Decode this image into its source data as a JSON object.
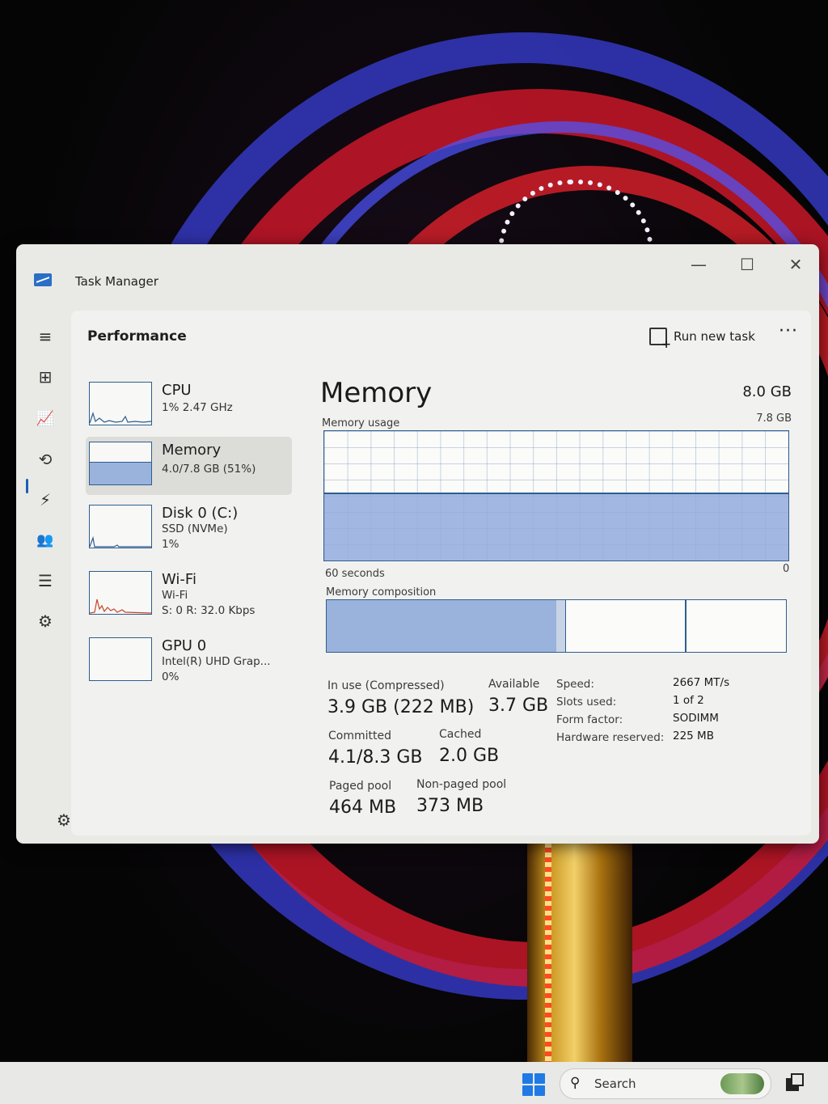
{
  "window": {
    "title": "Task Manager",
    "minimize_glyph": "—",
    "maximize_glyph": "☐",
    "close_glyph": "✕"
  },
  "nav": {
    "items": [
      {
        "icon": "hamburger-menu-icon",
        "glyph": "≡"
      },
      {
        "icon": "processes-icon",
        "glyph": "⊞"
      },
      {
        "icon": "performance-icon",
        "glyph": "📈"
      },
      {
        "icon": "app-history-icon",
        "glyph": "⟲"
      },
      {
        "icon": "startup-apps-icon",
        "glyph": "⚡"
      },
      {
        "icon": "users-icon",
        "glyph": "👥"
      },
      {
        "icon": "details-icon",
        "glyph": "☰"
      },
      {
        "icon": "services-icon",
        "glyph": "⚙"
      }
    ],
    "settings_glyph": "⚙"
  },
  "header": {
    "title": "Performance",
    "run_new_task_label": "Run new task",
    "more_glyph": "···"
  },
  "resources": [
    {
      "name": "CPU",
      "line1": "1% 2.47 GHz",
      "line2": ""
    },
    {
      "name": "Memory",
      "line1": "4.0/7.8 GB (51%)",
      "line2": ""
    },
    {
      "name": "Disk 0 (C:)",
      "line1": "SSD (NVMe)",
      "line2": "1%"
    },
    {
      "name": "Wi-Fi",
      "line1": "Wi-Fi",
      "line2": "S: 0 R: 32.0 Kbps"
    },
    {
      "name": "GPU 0",
      "line1": "Intel(R) UHD Grap...",
      "line2": "0%"
    }
  ],
  "memory_panel": {
    "title": "Memory",
    "total": "8.0 GB",
    "usage_label": "Memory usage",
    "usage_max": "7.8 GB",
    "time_span": "60 seconds",
    "axis_min": "0",
    "usage_fraction": 0.51,
    "composition_label": "Memory composition",
    "composition": {
      "in_use_fraction": 0.5,
      "modified_fraction": 0.02,
      "standby_fraction": 0.26,
      "free_fraction": 0.22
    },
    "stats": {
      "in_use_label": "In use (Compressed)",
      "in_use_value": "3.9 GB (222 MB)",
      "available_label": "Available",
      "available_value": "3.7 GB",
      "committed_label": "Committed",
      "committed_value": "4.1/8.3 GB",
      "cached_label": "Cached",
      "cached_value": "2.0 GB",
      "paged_pool_label": "Paged pool",
      "paged_pool_value": "464 MB",
      "non_paged_pool_label": "Non-paged pool",
      "non_paged_pool_value": "373 MB"
    },
    "specs": {
      "speed_label": "Speed:",
      "speed_value": "2667 MT/s",
      "slots_label": "Slots used:",
      "slots_value": "1 of 2",
      "form_factor_label": "Form factor:",
      "form_factor_value": "SODIMM",
      "hw_reserved_label": "Hardware reserved:",
      "hw_reserved_value": "225 MB"
    }
  },
  "taskbar": {
    "search_placeholder": "Search",
    "search_glyph": "⚲"
  },
  "colors": {
    "graph_line": "#2e5d8f",
    "graph_fill": "#9ab3dc",
    "accent": "#1c5fb8"
  }
}
